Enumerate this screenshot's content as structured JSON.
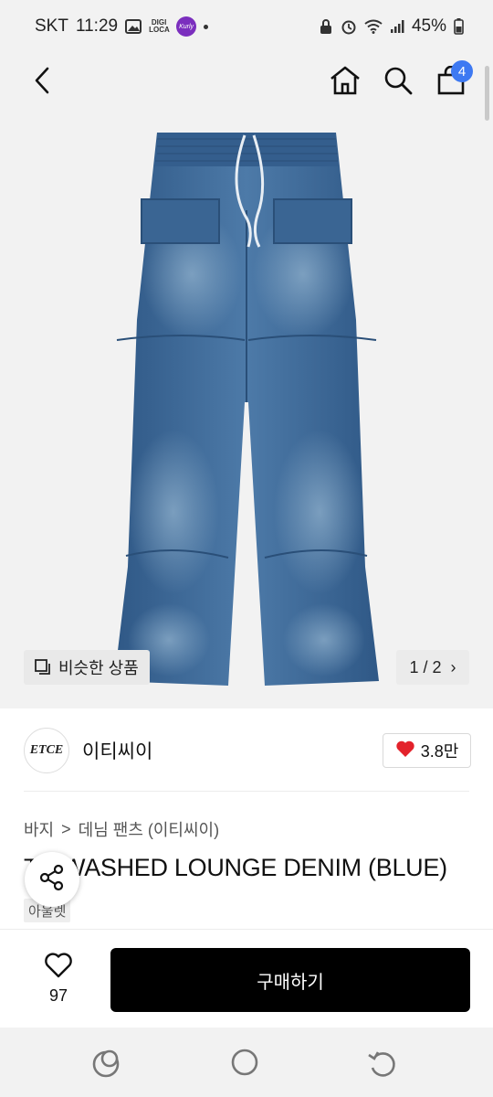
{
  "status_bar": {
    "carrier": "SKT",
    "time": "11:29",
    "digi_loca": "DIGI LOCA",
    "kurly": "Kurly",
    "battery": "45%"
  },
  "nav": {
    "cart_count": "4"
  },
  "gallery": {
    "similar_label": "비슷한 상품",
    "page_indicator": "1 / 2",
    "chevron": "›"
  },
  "seller": {
    "logo_text": "ETCE",
    "name": "이티씨이",
    "likes": "3.8만"
  },
  "product": {
    "breadcrumb": [
      "바지",
      "데님 팬츠 (이티씨이)"
    ],
    "breadcrumb_separator": ">",
    "title": "T... WASHED LOUNGE DENIM (BLUE)",
    "tag": "아울렛"
  },
  "action_bar": {
    "wish_count": "97",
    "buy_label": "구매하기"
  },
  "colors": {
    "accent_badge": "#3d79f2",
    "heart": "#e3222b",
    "buy_button": "#000000",
    "denim": "#3f6a98"
  },
  "icons": [
    "back-arrow-icon",
    "home-icon",
    "search-icon",
    "shopping-bag-icon",
    "similar-items-icon",
    "heart-icon",
    "share-icon",
    "heart-outline-icon",
    "recent-apps-icon",
    "home-circle-icon",
    "nav-back-icon"
  ]
}
